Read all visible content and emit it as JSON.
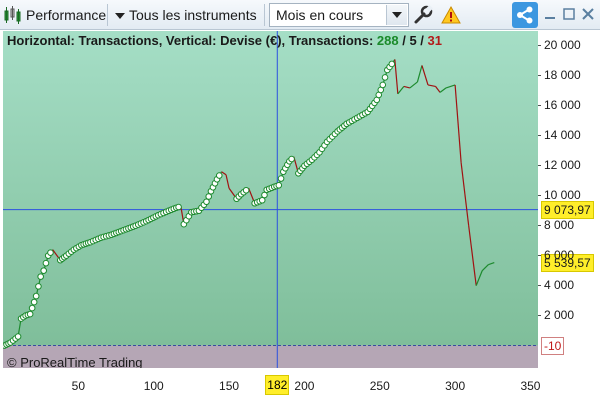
{
  "toolbar": {
    "performance_label": "Performance",
    "instruments_label": "Tous les instruments",
    "period_select_value": "Mois en cours",
    "icons": [
      "performance-chart-icon",
      "dropdown-triangle-icon",
      "wrench-icon",
      "warning-icon",
      "share-icon",
      "minimize-icon",
      "maximize-icon",
      "close-icon"
    ]
  },
  "chart": {
    "title_prefix": "Horizontal: Transactions, Vertical: Devise (€), Transactions: ",
    "count_total": "288",
    "count_sep1": " / ",
    "count_neutral": "5",
    "count_sep2": " / ",
    "count_losing": "31",
    "watermark": "© ProRealTime Trading",
    "crosshair_x_label": "182",
    "crosshair_y_label": "9 073,97",
    "last_value_label": "5 539,57",
    "drawdown_label": "-10"
  },
  "colors": {
    "plot_gradient_top": "#a5dec6",
    "plot_gradient_bottom": "#7fbe9a",
    "negative_zone": "#b5a6b5",
    "line_up": "#1d8a2e",
    "line_down": "#a01212",
    "crosshair": "#2b50e0",
    "tag_yellow": "#ffee2a"
  },
  "chart_data": {
    "type": "line",
    "xlabel": "Transactions",
    "ylabel": "Devise (€)",
    "xlim": [
      0,
      355
    ],
    "ylim": [
      -1500,
      21000
    ],
    "x_ticks": [
      "50",
      "100",
      "150",
      "200",
      "250",
      "300",
      "350"
    ],
    "y_ticks": [
      "20 000",
      "18 000",
      "16 000",
      "14 000",
      "12 000",
      "10 000",
      "8 000",
      "6 000",
      "4 000",
      "2 000"
    ],
    "grid": false,
    "series": [
      {
        "points": [
          [
            1,
            0
          ],
          [
            5,
            200
          ],
          [
            10,
            600
          ],
          [
            12,
            1800
          ],
          [
            15,
            2000
          ],
          [
            18,
            2100
          ],
          [
            22,
            3300
          ],
          [
            25,
            4600
          ],
          [
            27,
            5000
          ],
          [
            30,
            6000
          ],
          [
            33,
            6400
          ],
          [
            38,
            5700
          ],
          [
            42,
            6000
          ],
          [
            47,
            6400
          ],
          [
            52,
            6700
          ],
          [
            58,
            6900
          ],
          [
            65,
            7200
          ],
          [
            72,
            7400
          ],
          [
            80,
            7700
          ],
          [
            88,
            8000
          ],
          [
            95,
            8300
          ],
          [
            103,
            8700
          ],
          [
            110,
            9000
          ],
          [
            115,
            9200
          ],
          [
            118,
            9300
          ],
          [
            120,
            8100
          ],
          [
            125,
            8900
          ],
          [
            130,
            9000
          ],
          [
            135,
            9600
          ],
          [
            138,
            10300
          ],
          [
            142,
            11100
          ],
          [
            145,
            11600
          ],
          [
            148,
            11400
          ],
          [
            150,
            10500
          ],
          [
            155,
            9800
          ],
          [
            158,
            10100
          ],
          [
            163,
            10500
          ],
          [
            167,
            9500
          ],
          [
            172,
            9700
          ],
          [
            175,
            10400
          ],
          [
            180,
            10600
          ],
          [
            183,
            10700
          ],
          [
            186,
            11600
          ],
          [
            190,
            12300
          ],
          [
            193,
            12600
          ],
          [
            196,
            11500
          ],
          [
            200,
            12000
          ],
          [
            205,
            12400
          ],
          [
            210,
            12900
          ],
          [
            215,
            13600
          ],
          [
            222,
            14300
          ],
          [
            228,
            14800
          ],
          [
            235,
            15200
          ],
          [
            242,
            15600
          ],
          [
            248,
            16400
          ],
          [
            252,
            17400
          ],
          [
            255,
            18400
          ],
          [
            258,
            18800
          ],
          [
            260,
            19100
          ],
          [
            262,
            16800
          ],
          [
            266,
            17300
          ],
          [
            270,
            17200
          ],
          [
            275,
            17600
          ],
          [
            278,
            18700
          ],
          [
            282,
            17400
          ],
          [
            287,
            17300
          ],
          [
            290,
            16900
          ],
          [
            294,
            17200
          ],
          [
            300,
            17400
          ],
          [
            304,
            12200
          ],
          [
            309,
            8000
          ],
          [
            314,
            4000
          ],
          [
            318,
            5000
          ],
          [
            322,
            5400
          ],
          [
            326,
            5540
          ]
        ],
        "up_color": "#1d8a2e",
        "down_color": "#a01212",
        "markers_until_x": 262
      }
    ],
    "crosshair": {
      "x": 182,
      "y": 9073.97
    },
    "reference_line": {
      "y": 0,
      "style": "dashed"
    },
    "last_value": 5539.57
  }
}
